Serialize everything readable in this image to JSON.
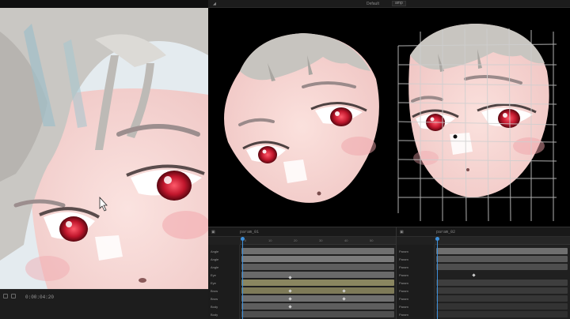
{
  "left_panel": {
    "timecode": "0:00:04:20",
    "controls": [
      "record-icon",
      "play-icon",
      "menu-icon"
    ]
  },
  "viewport": {
    "tab_label": "Default",
    "dropdown_label": "amp",
    "overlay": "deform-grid"
  },
  "timeline": {
    "left_header": "param_01",
    "right_header": "param_02",
    "ruler_ticks": [
      "0",
      "10",
      "20",
      "30",
      "40",
      "50"
    ],
    "tracks_left": [
      "Angle",
      "Angle",
      "Angle",
      "Eye",
      "Eye",
      "Brow",
      "Brow",
      "Body",
      "Body"
    ],
    "tracks_right": [
      "Param",
      "Param",
      "Param",
      "Param",
      "Param",
      "Param",
      "Param",
      "Param",
      "Param"
    ]
  },
  "colors": {
    "accent": "#3d8fd9",
    "track_gray": "#7a7a7a",
    "track_olive": "#8a8660",
    "track_dark": "#5e5e5e"
  }
}
